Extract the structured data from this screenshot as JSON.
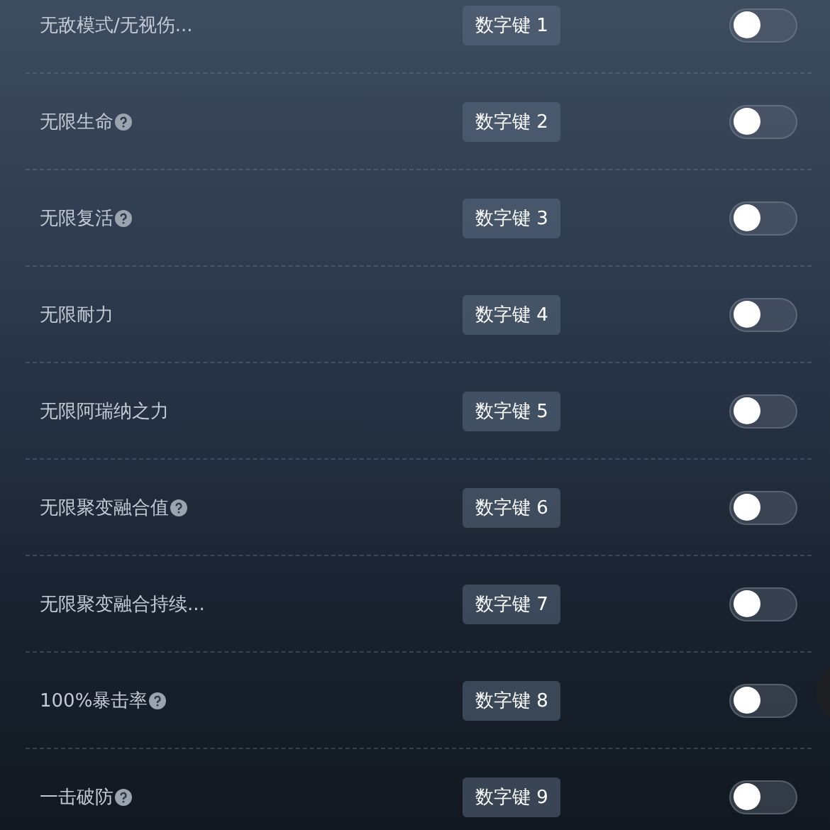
{
  "rows": [
    {
      "label": "无敌模式/无视伤...",
      "help": false,
      "hotkey": "数字键 1",
      "on": false
    },
    {
      "label": "无限生命",
      "help": true,
      "hotkey": "数字键 2",
      "on": false
    },
    {
      "label": "无限复活",
      "help": true,
      "hotkey": "数字键 3",
      "on": false
    },
    {
      "label": "无限耐力",
      "help": false,
      "hotkey": "数字键 4",
      "on": false
    },
    {
      "label": "无限阿瑞纳之力",
      "help": false,
      "hotkey": "数字键 5",
      "on": false
    },
    {
      "label": "无限聚变融合值",
      "help": true,
      "hotkey": "数字键 6",
      "on": false
    },
    {
      "label": "无限聚变融合持续...",
      "help": false,
      "hotkey": "数字键 7",
      "on": false
    },
    {
      "label": "100%暴击率",
      "help": true,
      "hotkey": "数字键 8",
      "on": false
    },
    {
      "label": "一击破防",
      "help": true,
      "hotkey": "数字键 9",
      "on": false
    }
  ]
}
